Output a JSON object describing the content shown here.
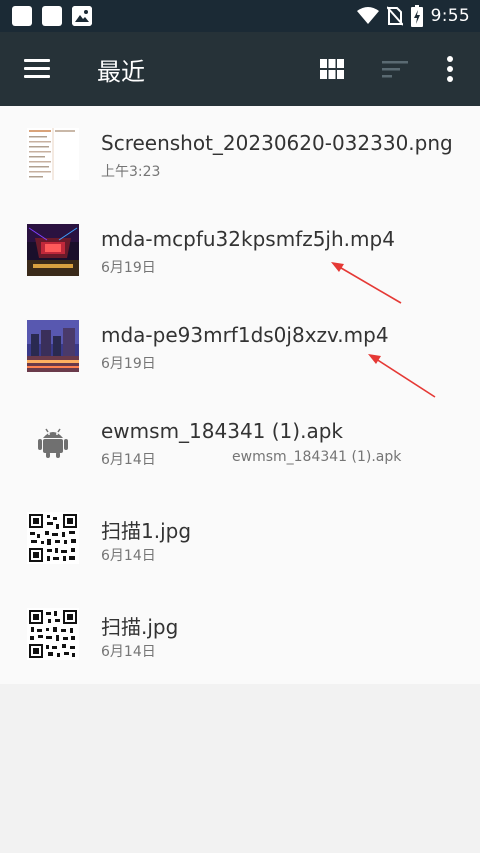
{
  "status_bar": {
    "time": "9:55",
    "icons": [
      "notification-square-icon",
      "notification-square-icon",
      "image-notification-icon",
      "wifi-icon",
      "no-sim-icon",
      "battery-charging-icon"
    ]
  },
  "toolbar": {
    "title": "最近",
    "icons": [
      "menu-icon",
      "grid-view-icon",
      "sort-icon",
      "more-vert-icon"
    ]
  },
  "files": [
    {
      "name": "Screenshot_20230620-032330.png",
      "date": "上午3:23",
      "summary": "",
      "thumb": "document-thumbnail"
    },
    {
      "name": "mda-mcpfu32kpsmfz5jh.mp4",
      "date": "6月19日",
      "summary": "",
      "thumb": "video-thumbnail-night-stage"
    },
    {
      "name": "mda-pe93mrf1ds0j8xzv.mp4",
      "date": "6月19日",
      "summary": "",
      "thumb": "video-thumbnail-city-night"
    },
    {
      "name": "ewmsm_184341 (1).apk",
      "date": "6月14日",
      "summary": "ewmsm_184341 (1).apk",
      "thumb": "android-icon"
    },
    {
      "name": "扫描1.jpg",
      "date": "6月14日",
      "summary": "",
      "thumb": "qr-code-thumbnail"
    },
    {
      "name": "扫描.jpg",
      "date": "6月14日",
      "summary": "",
      "thumb": "qr-code-thumbnail"
    }
  ],
  "colors": {
    "status_bar": "#1b2a35",
    "toolbar": "#263238",
    "annotation_arrow": "#e53935"
  }
}
